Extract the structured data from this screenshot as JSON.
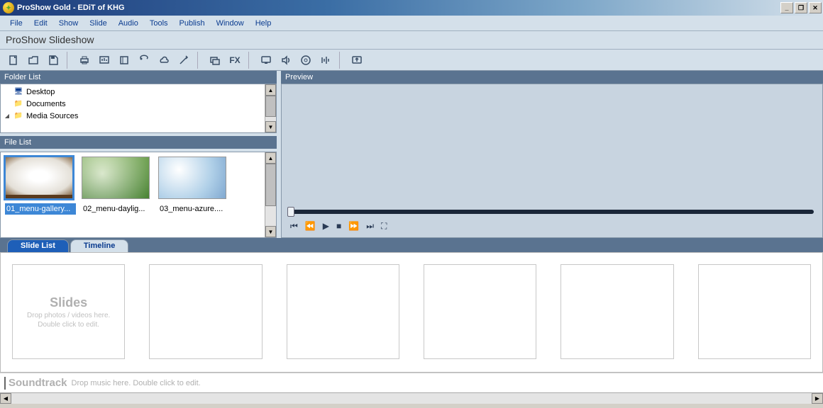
{
  "title": "ProShow Gold - EDiT of KHG",
  "menus": [
    "File",
    "Edit",
    "Show",
    "Slide",
    "Audio",
    "Tools",
    "Publish",
    "Window",
    "Help"
  ],
  "show_title": "ProShow Slideshow",
  "panels": {
    "folder_header": "Folder List",
    "file_header": "File List",
    "preview_header": "Preview"
  },
  "folders": [
    {
      "name": "Desktop",
      "icon": "desktop"
    },
    {
      "name": "Documents",
      "icon": "folder"
    },
    {
      "name": "Media Sources",
      "icon": "folder",
      "expand": "▹"
    }
  ],
  "files": [
    {
      "name": "01_menu-gallery...",
      "sel": true,
      "cls": "img1"
    },
    {
      "name": "02_menu-daylig...",
      "sel": false,
      "cls": "img2"
    },
    {
      "name": "03_menu-azure....",
      "sel": false,
      "cls": "img3"
    }
  ],
  "tabs": {
    "slide_list": "Slide List",
    "timeline": "Timeline"
  },
  "slides_hint": {
    "title": "Slides",
    "line1": "Drop photos / videos here.",
    "line2": "Double click to edit."
  },
  "soundtrack": {
    "title": "Soundtrack",
    "hint": "Drop music here.  Double click to edit."
  },
  "fx_label": "FX"
}
